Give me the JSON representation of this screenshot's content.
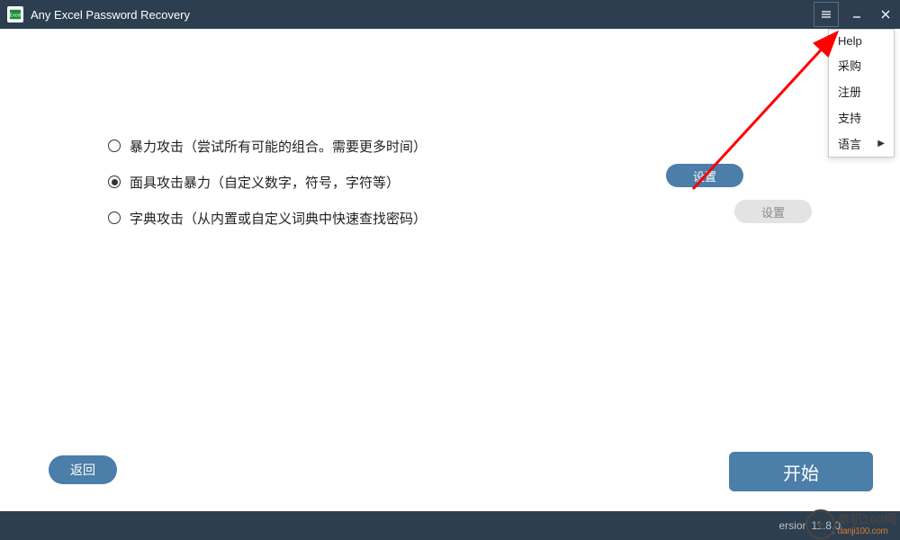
{
  "titlebar": {
    "title": "Any Excel Password Recovery"
  },
  "options": [
    {
      "label": "暴力攻击（尝试所有可能的组合。需要更多时间）",
      "selected": false
    },
    {
      "label": "面具攻击暴力（自定义数字，符号，字符等）",
      "selected": true
    },
    {
      "label": "字典攻击（从内置或自定义词典中快速查找密码）",
      "selected": false
    }
  ],
  "buttons": {
    "settings_mask": "设置",
    "settings_dict": "设置",
    "back": "返回",
    "start": "开始"
  },
  "menu": {
    "items": [
      {
        "label": "Help",
        "submenu": false
      },
      {
        "label": "采购",
        "submenu": false
      },
      {
        "label": "注册",
        "submenu": false
      },
      {
        "label": "支持",
        "submenu": false
      },
      {
        "label": "语言",
        "submenu": true
      }
    ]
  },
  "footer": {
    "version": "ersion 11.8.0"
  },
  "watermark": {
    "cn": "单机100网",
    "url": "danji100.com"
  }
}
